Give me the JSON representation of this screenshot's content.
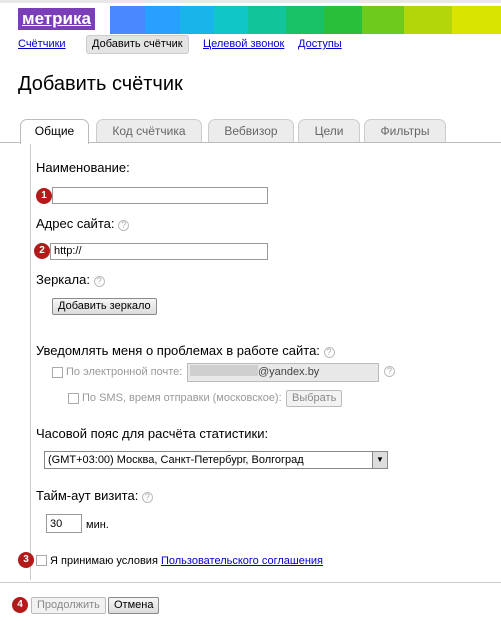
{
  "logo": {
    "text": "метрика",
    "band_colors": [
      "#3b7bff",
      "#2f9bff",
      "#18b6e8",
      "#13c7c7",
      "#16c090",
      "#1fbf5a",
      "#42c72d",
      "#8bd21f",
      "#c8d700",
      "#a9d800"
    ]
  },
  "nav": {
    "counters": "Счётчики",
    "add_counter": "Добавить счётчик",
    "target_call": "Целевой звонок",
    "access": "Доступы"
  },
  "page_title": "Добавить счётчик",
  "tabs": [
    {
      "label": "Общие",
      "active": true
    },
    {
      "label": "Код счётчика",
      "active": false
    },
    {
      "label": "Вебвизор",
      "active": false
    },
    {
      "label": "Цели",
      "active": false
    },
    {
      "label": "Фильтры",
      "active": false
    }
  ],
  "form": {
    "name_label": "Наименование:",
    "name_value": "",
    "site_label": "Адрес сайта:",
    "site_value": "http://",
    "mirrors_label": "Зеркала:",
    "add_mirror_button": "Добавить зеркало",
    "notify_label": "Уведомлять меня о проблемах в работе сайта:",
    "email_option": "По электронной почте:",
    "email_value": "@yandex.by",
    "sms_option": "По SMS, время отправки (московское):",
    "sms_choose_button": "Выбрать",
    "timezone_label": "Часовой пояс для расчёта статистики:",
    "timezone_value": "(GMT+03:00) Москва, Санкт-Петербург, Волгоград",
    "timeout_label": "Тайм-аут визита:",
    "timeout_value": "30",
    "timeout_unit": "мин.",
    "agree_text": "Я принимаю условия",
    "agree_link": "Пользовательского соглашения",
    "help_glyph": "?"
  },
  "actions": {
    "continue": "Продолжить",
    "cancel": "Отмена"
  },
  "markers": [
    "1",
    "2",
    "3",
    "4"
  ]
}
